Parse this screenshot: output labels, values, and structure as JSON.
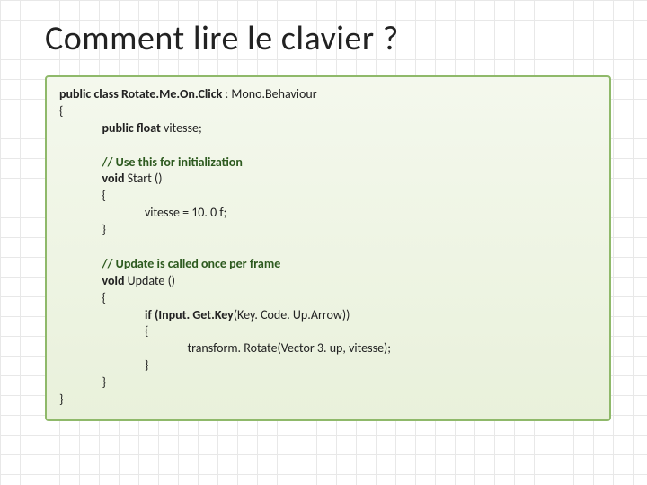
{
  "title": "Comment lire le clavier ?",
  "code": {
    "l1a": "public class ",
    "l1b": "Rotate.Me.On.Click ",
    "l1c": ": Mono.Behaviour",
    "l2": "{",
    "l3a": "public float ",
    "l3b": "vitesse;",
    "l5": "// Use this for initialization",
    "l6a": "void ",
    "l6b": "Start ()",
    "l7": "{",
    "l8": "vitesse = 10. 0 f;",
    "l9": "}",
    "l11": "// Update is called once per frame",
    "l12a": "void ",
    "l12b": "Update ()",
    "l13": "{",
    "l14a": "if (",
    "l14b": "Input. Get.Key",
    "l14c": "(Key. Code. Up.Arrow))",
    "l15": "{",
    "l16": "transform. Rotate(Vector 3. up, vitesse);",
    "l17": "}",
    "l18": "}",
    "l19": "}"
  }
}
